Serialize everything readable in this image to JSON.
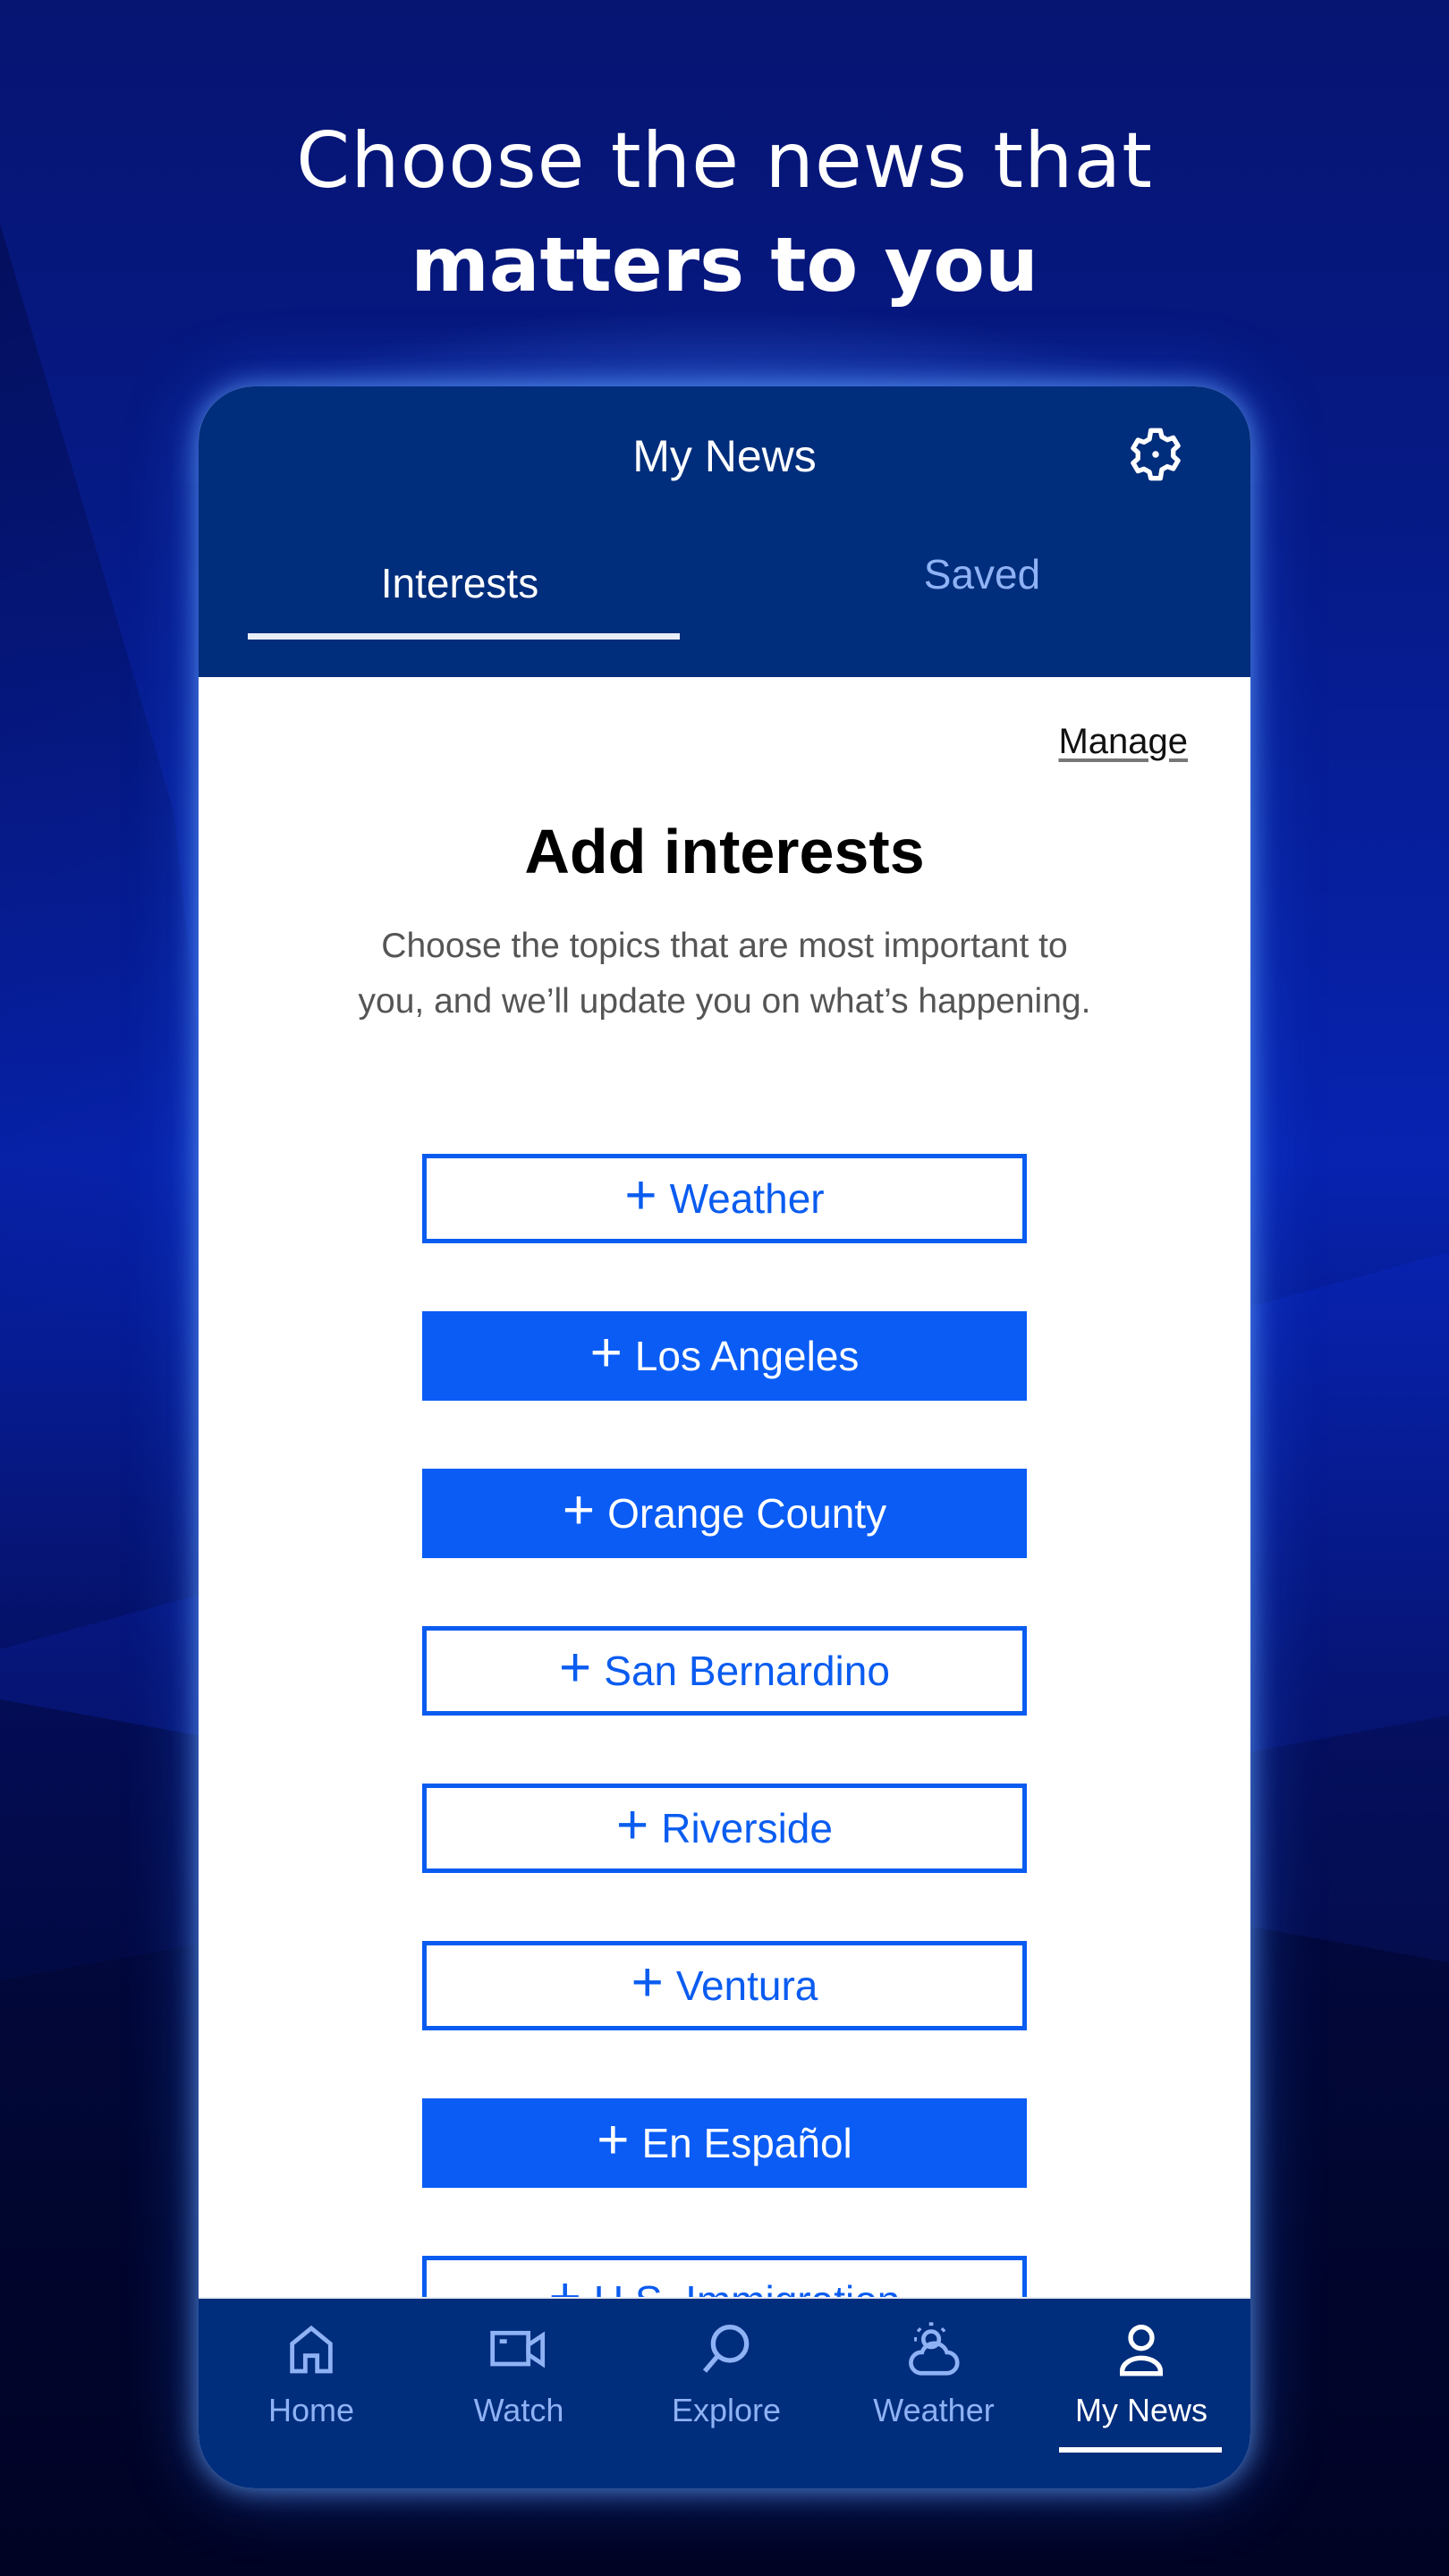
{
  "promo": {
    "headline_line1": "Choose the news that",
    "headline_line2": "matters to you"
  },
  "app": {
    "title": "My News",
    "settings_icon": "gear-icon",
    "tabs": [
      {
        "label": "Interests",
        "active": true
      },
      {
        "label": "Saved",
        "active": false
      }
    ]
  },
  "content": {
    "manage_label": "Manage",
    "title": "Add interests",
    "description": "Choose the topics that are most important to you, and we’ll update you on what’s happening.",
    "interests": [
      {
        "label": "Weather",
        "style": "outline"
      },
      {
        "label": "Los Angeles",
        "style": "filled"
      },
      {
        "label": "Orange County",
        "style": "filled"
      },
      {
        "label": "San Bernardino",
        "style": "outline"
      },
      {
        "label": "Riverside",
        "style": "outline"
      },
      {
        "label": "Ventura",
        "style": "outline"
      },
      {
        "label": "En Español",
        "style": "filled"
      },
      {
        "label": "U.S. Immigration",
        "style": "outline"
      }
    ],
    "plus_icon": "+"
  },
  "bottom_nav": {
    "items": [
      {
        "label": "Home",
        "icon": "home-icon",
        "active": false
      },
      {
        "label": "Watch",
        "icon": "video-camera-icon",
        "active": false
      },
      {
        "label": "Explore",
        "icon": "search-icon",
        "active": false
      },
      {
        "label": "Weather",
        "icon": "partly-cloudy-icon",
        "active": false
      },
      {
        "label": "My News",
        "icon": "person-icon",
        "active": true
      }
    ]
  },
  "colors": {
    "header_bg": "#002d7c",
    "accent_blue": "#0a5cf5",
    "inactive_text": "#8fb2f5",
    "background_navy": "#061472"
  }
}
